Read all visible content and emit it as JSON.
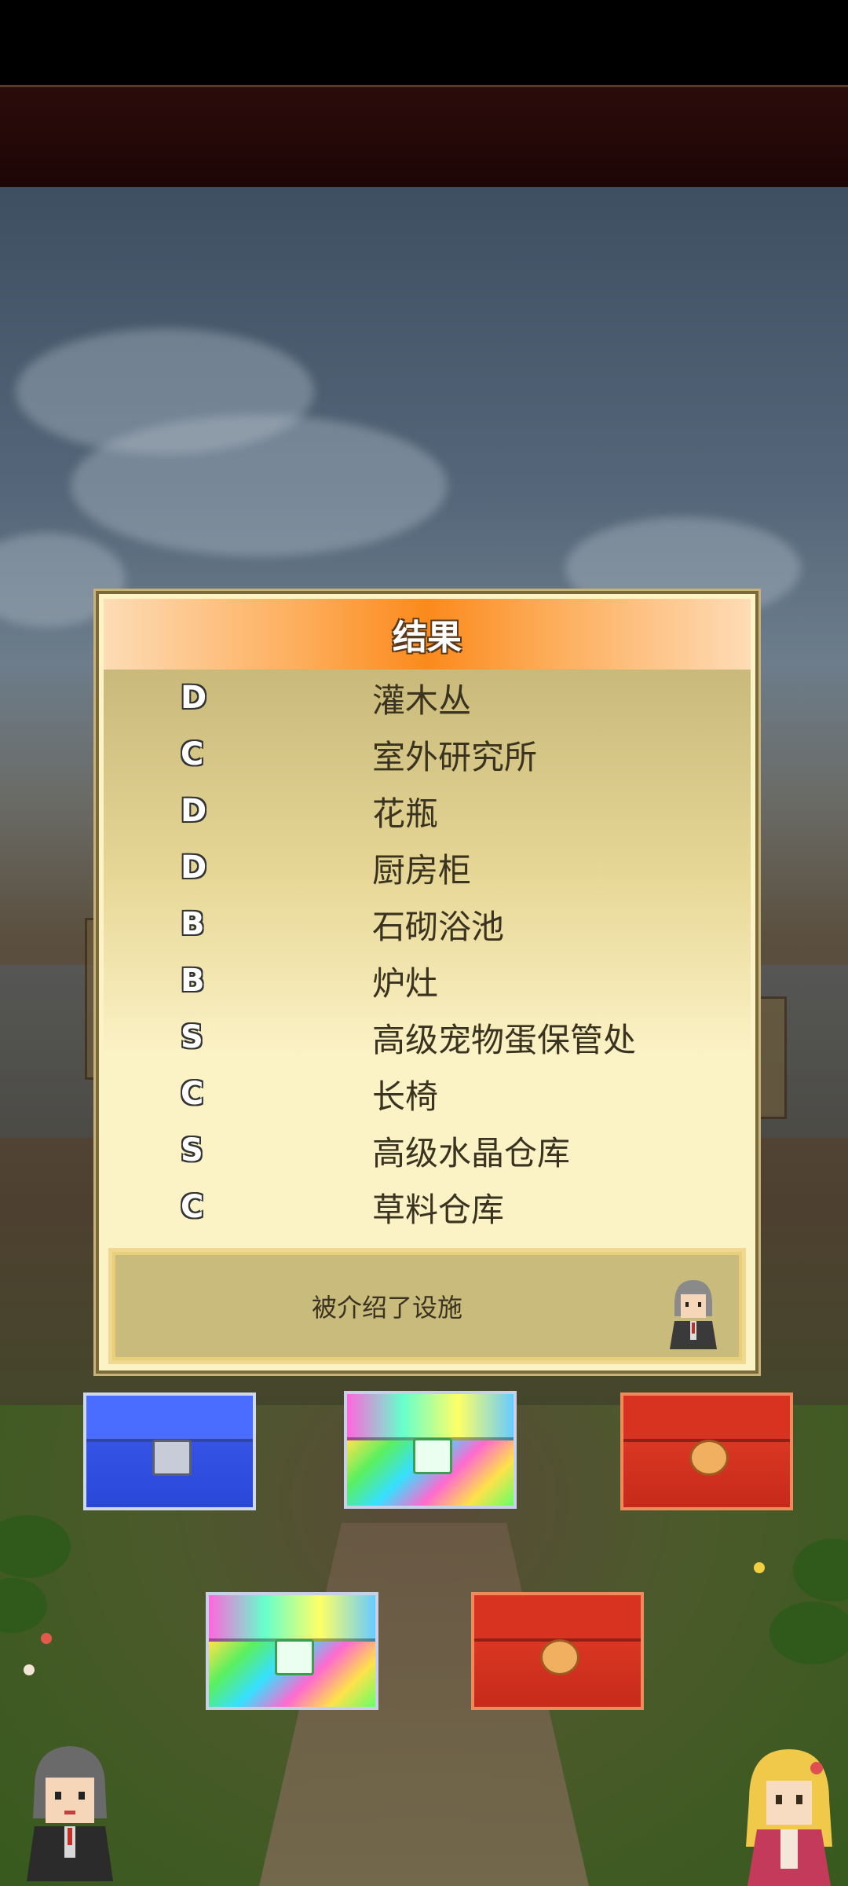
{
  "dialog": {
    "title": "结果",
    "results": [
      {
        "rank": "D",
        "facility": "灌木丛"
      },
      {
        "rank": "C",
        "facility": "室外研究所"
      },
      {
        "rank": "D",
        "facility": "花瓶"
      },
      {
        "rank": "D",
        "facility": "厨房柜"
      },
      {
        "rank": "B",
        "facility": "石砌浴池"
      },
      {
        "rank": "B",
        "facility": "炉灶"
      },
      {
        "rank": "S",
        "facility": "高级宠物蛋保管处"
      },
      {
        "rank": "C",
        "facility": "长椅"
      },
      {
        "rank": "S",
        "facility": "高级水晶仓库"
      },
      {
        "rank": "C",
        "facility": "草料仓库"
      }
    ],
    "message": "被介绍了设施"
  },
  "chests": [
    {
      "type": "blue-chest-icon"
    },
    {
      "type": "rainbow-chest-icon"
    },
    {
      "type": "red-chest-icon"
    },
    {
      "type": "rainbow-chest-icon"
    },
    {
      "type": "red-chest-icon"
    }
  ],
  "colors": {
    "header_orange": "#fb8a1c",
    "dialog_bg": "#fbf2c6",
    "banner": "#1e0606"
  }
}
